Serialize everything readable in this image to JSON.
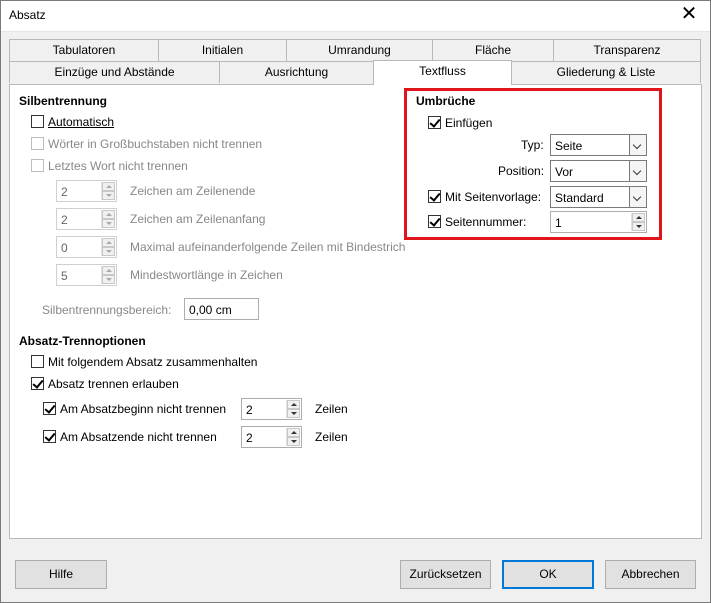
{
  "window": {
    "title": "Absatz",
    "close_symbol": "✕"
  },
  "tabs_row1": [
    "Tabulatoren",
    "Initialen",
    "Umrandung",
    "Fläche",
    "Transparenz"
  ],
  "tabs_row2": [
    "Einzüge und Abstände",
    "Ausrichtung",
    "Textfluss",
    "Gliederung & Liste"
  ],
  "active_tab": "Textfluss",
  "silbentrennung": {
    "heading": "Silbentrennung",
    "automatisch": {
      "label": "Automatisch",
      "checked": false
    },
    "grossbuchstaben": {
      "label": "Wörter in Großbuchstaben nicht trennen",
      "checked": false,
      "disabled": true
    },
    "letztes_wort": {
      "label": "Letztes Wort nicht trennen",
      "checked": false,
      "disabled": true
    },
    "zeilenende": {
      "value": "2",
      "label": "Zeichen am Zeilenende"
    },
    "zeilenanfang": {
      "value": "2",
      "label": "Zeichen am Zeilenanfang"
    },
    "max_zeilen": {
      "value": "0",
      "label": "Maximal aufeinanderfolgende Zeilen mit Bindestrich"
    },
    "mindestwortlaenge": {
      "value": "5",
      "label": "Mindestwortlänge in Zeichen"
    },
    "bereich": {
      "label": "Silbentrennungsbereich:",
      "value": "0,00 cm"
    }
  },
  "umbrueche": {
    "heading": "Umbrüche",
    "einfuegen": {
      "label": "Einfügen",
      "checked": true
    },
    "typ": {
      "label": "Typ:",
      "value": "Seite"
    },
    "position": {
      "label": "Position:",
      "value": "Vor"
    },
    "seitenvorlage": {
      "label": "Mit Seitenvorlage:",
      "checked": true,
      "value": "Standard"
    },
    "seitennummer": {
      "label": "Seitennummer:",
      "checked": true,
      "value": "1"
    }
  },
  "trennoptionen": {
    "heading": "Absatz-Trennoptionen",
    "zusammenhalten": {
      "label": "Mit folgendem Absatz zusammenhalten",
      "checked": false
    },
    "trennen_erlauben": {
      "label": "Absatz trennen erlauben",
      "checked": true
    },
    "absatzbeginn": {
      "label": "Am Absatzbeginn nicht trennen",
      "checked": true,
      "value": "2",
      "unit": "Zeilen"
    },
    "absatzende": {
      "label": "Am Absatzende nicht trennen",
      "checked": true,
      "value": "2",
      "unit": "Zeilen"
    }
  },
  "buttons": {
    "hilfe": "Hilfe",
    "zuruecksetzen": "Zurücksetzen",
    "ok": "OK",
    "abbrechen": "Abbrechen"
  },
  "colors": {
    "highlight": "#e0151b",
    "default_button": "#0078d7"
  }
}
